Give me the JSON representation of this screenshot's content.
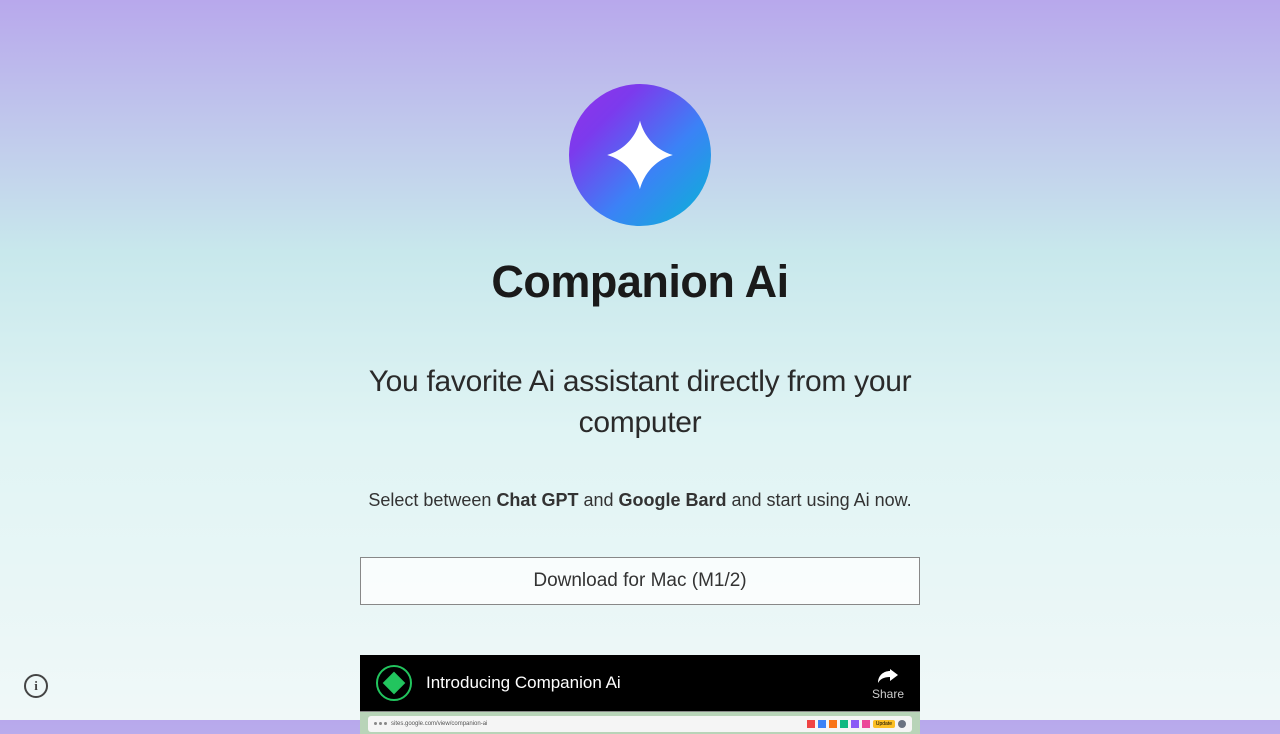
{
  "header": {
    "title": "Companion Ai"
  },
  "hero": {
    "subtitle": "You favorite Ai assistant directly from your computer",
    "description_prefix": "Select between ",
    "description_bold1": "Chat GPT",
    "description_mid": " and ",
    "description_bold2": "Google Bard",
    "description_suffix": " and start using Ai now."
  },
  "cta": {
    "download_label": "Download for Mac (M1/2)"
  },
  "video": {
    "title": "Introducing Companion Ai",
    "share_label": "Share",
    "chrome_url": "sites.google.com/view/companion-ai",
    "update_label": "Update"
  },
  "footer": {
    "info_label": "i"
  }
}
